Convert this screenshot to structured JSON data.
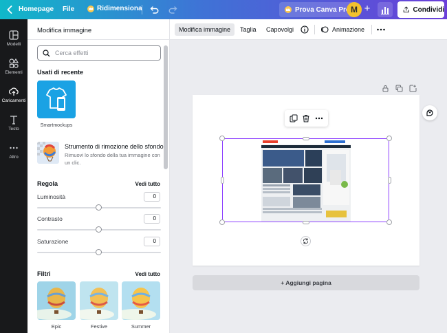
{
  "topbar": {
    "home_label": "Homepage",
    "file_label": "File",
    "resize_label": "Ridimensiona",
    "try_pro_label": "Prova Canva Pro",
    "avatar_initial": "M",
    "share_label": "Condividi"
  },
  "rail": {
    "items": [
      {
        "label": "Modelli",
        "icon": "templates-icon"
      },
      {
        "label": "Elementi",
        "icon": "elements-icon"
      },
      {
        "label": "Caricamenti",
        "icon": "upload-cloud-icon"
      },
      {
        "label": "Testo",
        "icon": "text-icon"
      },
      {
        "label": "Altro",
        "icon": "more-dots-icon"
      }
    ],
    "active_index": 2
  },
  "panel": {
    "title": "Modifica immagine",
    "search_placeholder": "Cerca effetti",
    "recent_heading": "Usati di recente",
    "smartmockups_label": "Smartmockups",
    "bg_tool_title": "Strumento di rimozione dello sfondo",
    "bg_tool_desc": "Rimuovi lo sfondo della tua immagine con un clic.",
    "adjust_heading": "Regola",
    "adjust_see_all": "Vedi tutto",
    "sliders": [
      {
        "label": "Luminosità",
        "value": "0"
      },
      {
        "label": "Contrasto",
        "value": "0"
      },
      {
        "label": "Saturazione",
        "value": "0"
      }
    ],
    "filters_heading": "Filtri",
    "filters_see_all": "Vedi tutto",
    "filters": [
      {
        "label": "Epic"
      },
      {
        "label": "Festive"
      },
      {
        "label": "Summer"
      }
    ]
  },
  "context_toolbar": {
    "edit_image_label": "Modifica immagine",
    "crop_label": "Taglia",
    "flip_label": "Capovolgi",
    "animate_label": "Animazione"
  },
  "canvas": {
    "add_page_label": "+ Aggiungi pagina"
  },
  "colors": {
    "accent_purple": "#8b3dff",
    "rail_bg": "#18191b",
    "smartmockups_blue": "#1aa2e4"
  }
}
